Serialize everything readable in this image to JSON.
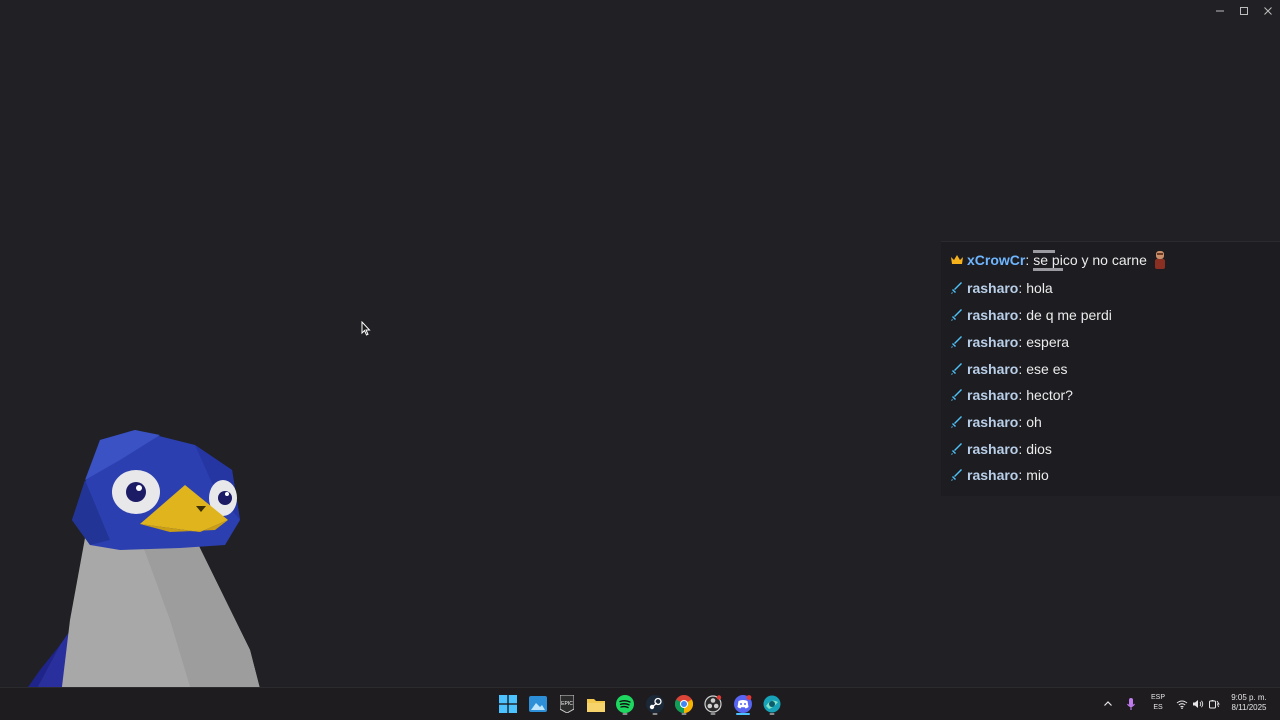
{
  "window": {
    "controls": [
      "minimize",
      "maximize",
      "close"
    ]
  },
  "chat": {
    "messages": [
      {
        "badge": "crown-icon",
        "user": "xCrowCr",
        "text": "se pico y no carne",
        "emote": "character-emote"
      },
      {
        "badge": "sword-icon",
        "user": "rasharo",
        "text": "hola"
      },
      {
        "badge": "sword-icon",
        "user": "rasharo",
        "text": "de q me perdi"
      },
      {
        "badge": "sword-icon",
        "user": "rasharo",
        "text": "espera"
      },
      {
        "badge": "sword-icon",
        "user": "rasharo",
        "text": "ese es"
      },
      {
        "badge": "sword-icon",
        "user": "rasharo",
        "text": "hector?"
      },
      {
        "badge": "sword-icon",
        "user": "rasharo",
        "text": "oh"
      },
      {
        "badge": "sword-icon",
        "user": "rasharo",
        "text": "dios"
      },
      {
        "badge": "sword-icon",
        "user": "rasharo",
        "text": "mio"
      }
    ],
    "colors": {
      "crown_user": "#6fb6ff",
      "mod_user": "#b9cfe8",
      "badge": "#4fc3f7"
    }
  },
  "taskbar": {
    "apps": [
      "start-icon",
      "photos-icon",
      "epic-games-icon",
      "file-explorer-icon",
      "spotify-icon",
      "steam-icon",
      "chrome-icon",
      "obs-icon",
      "discord-icon",
      "browser-icon"
    ],
    "tray": {
      "lang_line1": "ESP",
      "lang_line2": "ES",
      "time": "9:05 p. m.",
      "date": "8/11/2025"
    }
  }
}
